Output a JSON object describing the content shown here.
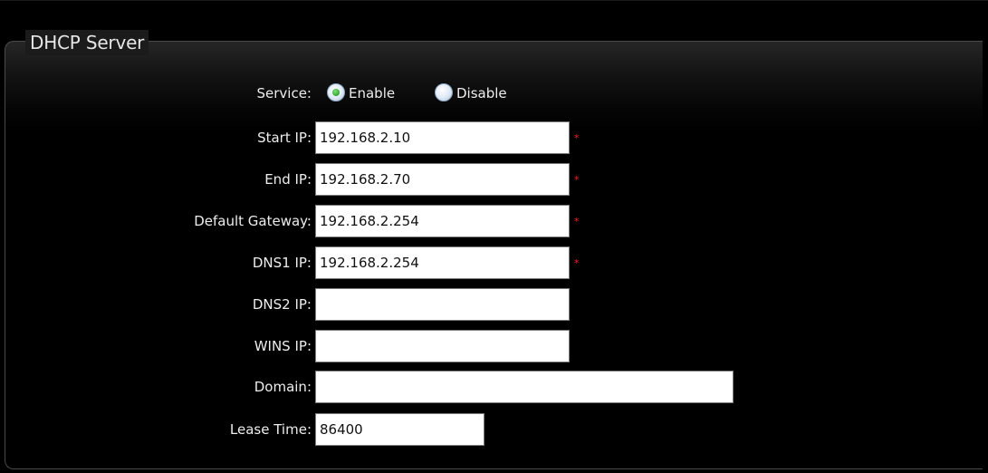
{
  "section": {
    "title": "DHCP Server"
  },
  "service": {
    "label": "Service:",
    "options": [
      {
        "label": "Enable",
        "selected": true
      },
      {
        "label": "Disable",
        "selected": false
      }
    ]
  },
  "fields": {
    "start_ip": {
      "label": "Start IP:",
      "value": "192.168.2.10",
      "required_mark": "*"
    },
    "end_ip": {
      "label": "End IP:",
      "value": "192.168.2.70",
      "required_mark": "*"
    },
    "default_gateway": {
      "label": "Default Gateway:",
      "value": "192.168.2.254",
      "required_mark": "*"
    },
    "dns1_ip": {
      "label": "DNS1 IP:",
      "value": "192.168.2.254",
      "required_mark": "*"
    },
    "dns2_ip": {
      "label": "DNS2 IP:",
      "value": ""
    },
    "wins_ip": {
      "label": "WINS IP:",
      "value": ""
    },
    "domain": {
      "label": "Domain:",
      "value": ""
    },
    "lease_time": {
      "label": "Lease Time:",
      "value": "86400"
    }
  },
  "colors": {
    "background": "#000000",
    "text": "#ededed",
    "required": "#ff2020",
    "radio_selected": "#2fa82a"
  }
}
